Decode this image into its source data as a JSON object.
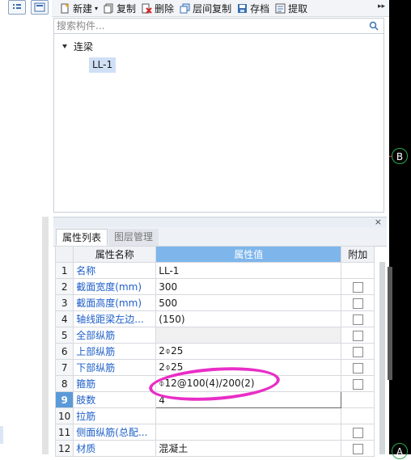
{
  "toolbar": {
    "new_label": "新建",
    "copy_label": "复制",
    "delete_label": "删除",
    "layer_copy_label": "层间复制",
    "archive_label": "存档",
    "extract_label": "提取"
  },
  "search": {
    "placeholder": "搜索构件..."
  },
  "tree": {
    "root_label": "连梁",
    "child_label": "LL-1"
  },
  "properties": {
    "tabs": [
      "属性列表",
      "图层管理"
    ],
    "headers": {
      "name": "属性名称",
      "value": "属性值",
      "extra": "附加"
    },
    "rows": [
      {
        "num": "1",
        "name": "名称",
        "value": "LL-1",
        "has_checkbox": false
      },
      {
        "num": "2",
        "name": "截面宽度(mm)",
        "value": "300",
        "has_checkbox": true
      },
      {
        "num": "3",
        "name": "截面高度(mm)",
        "value": "500",
        "has_checkbox": true
      },
      {
        "num": "4",
        "name": "轴线距梁左边...",
        "value": "(150)",
        "has_checkbox": true
      },
      {
        "num": "5",
        "name": "全部纵筋",
        "value": "",
        "has_checkbox": true
      },
      {
        "num": "6",
        "name": "上部纵筋",
        "value": "2⌽25",
        "has_checkbox": true
      },
      {
        "num": "7",
        "name": "下部纵筋",
        "value": "2⌽25",
        "has_checkbox": true
      },
      {
        "num": "8",
        "name": "箍筋",
        "value": "⌽12@100(4)/200(2)",
        "has_checkbox": true
      },
      {
        "num": "9",
        "name": "肢数",
        "value": "4",
        "has_checkbox": false
      },
      {
        "num": "10",
        "name": "拉筋",
        "value": "",
        "has_checkbox": false
      },
      {
        "num": "11",
        "name": "侧面纵筋(总配...",
        "value": "",
        "has_checkbox": true
      },
      {
        "num": "12",
        "name": "材质",
        "value": "混凝土",
        "has_checkbox": true
      }
    ]
  },
  "canvas": {
    "axis_top": "B",
    "axis_bottom": "A"
  },
  "colors": {
    "name_blue": "#1e5fc8",
    "header_highlight": "#7eb6ec",
    "annotation": "#e92ec7"
  }
}
